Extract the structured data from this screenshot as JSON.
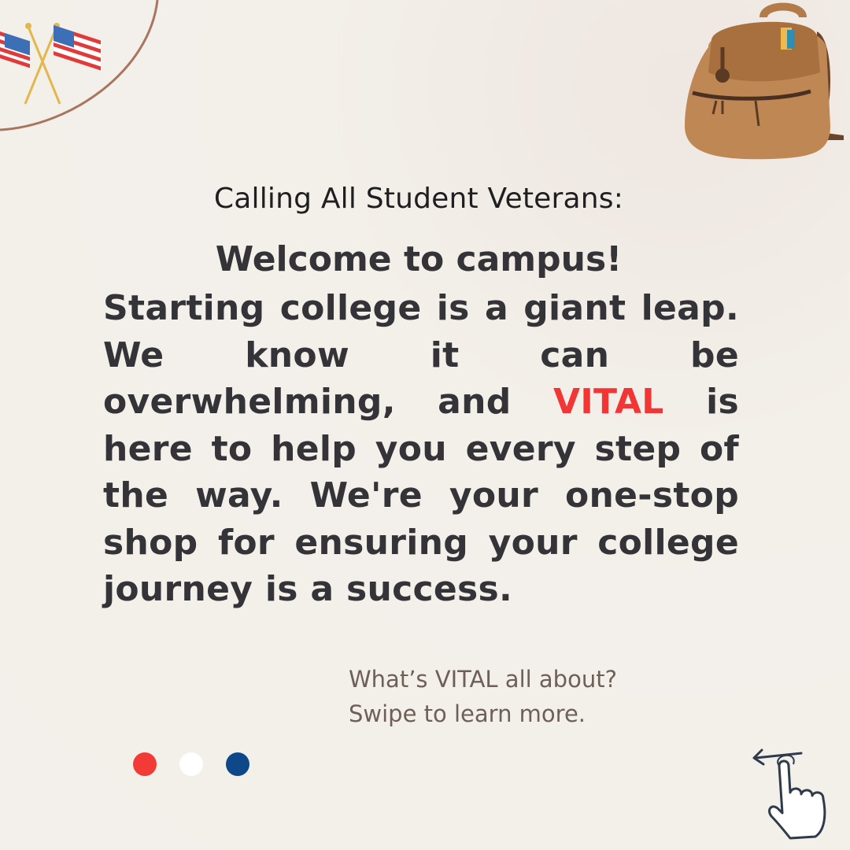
{
  "kicker": "Calling All Student Veterans:",
  "headline": "Welcome to campus!",
  "body": {
    "part1": "Starting college is a giant leap. We know it can be overwhelming, and ",
    "highlight": "VITAL",
    "part2": " is here to help you every step of the way. We're your one-stop shop for ensuring your college journey is a success."
  },
  "cta": {
    "line1": "What’s VITAL all about?",
    "line2": "Swipe to learn more."
  },
  "pagination": {
    "colors": [
      "#f23a37",
      "#ffffff",
      "#0f4889"
    ]
  },
  "icons": [
    "american-flags-icon",
    "backpack-icon",
    "swipe-hand-icon"
  ],
  "colors": {
    "background": "#f3f0eb",
    "text": "#333338",
    "accent": "#f23535",
    "cta_text": "#6e5f58"
  }
}
